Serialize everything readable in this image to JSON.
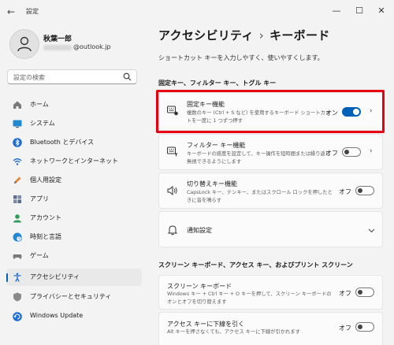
{
  "window": {
    "title": "設定"
  },
  "user": {
    "name": "秋葉一郎",
    "email_suffix": "@outlook.jp"
  },
  "search": {
    "placeholder": "設定の検索"
  },
  "nav": [
    {
      "label": "ホーム",
      "icon": "home-icon"
    },
    {
      "label": "システム",
      "icon": "monitor-icon"
    },
    {
      "label": "Bluetooth とデバイス",
      "icon": "bluetooth-icon"
    },
    {
      "label": "ネットワークとインターネット",
      "icon": "wifi-icon"
    },
    {
      "label": "個人用設定",
      "icon": "pen-icon"
    },
    {
      "label": "アプリ",
      "icon": "apps-icon"
    },
    {
      "label": "アカウント",
      "icon": "account-icon"
    },
    {
      "label": "時刻と言語",
      "icon": "clock-globe-icon"
    },
    {
      "label": "ゲーム",
      "icon": "gamepad-icon"
    },
    {
      "label": "アクセシビリティ",
      "icon": "accessibility-icon"
    },
    {
      "label": "プライバシーとセキュリティ",
      "icon": "shield-icon"
    },
    {
      "label": "Windows Update",
      "icon": "update-icon"
    }
  ],
  "main": {
    "breadcrumb_parent": "アクセシビリティ",
    "breadcrumb_sep": "›",
    "breadcrumb_current": "キーボード",
    "description": "ショートカット キーを入力しやすく、使いやすくします。",
    "section1_title": "固定キー、フィルター キー、トグル キー",
    "cards": [
      {
        "title": "固定キー機能",
        "desc": "複数のキー (Ctrl + S など) を使用するキーボード ショートカットを一度に 1 つずつ押す",
        "state": "オン",
        "on": true,
        "icon": "sticky-keys-icon"
      },
      {
        "title": "フィルター キー機能",
        "desc": "キーボードの感度を設定して、キー操作を短時間または繰り返し無視できるようにします",
        "state": "オフ",
        "on": false,
        "icon": "filter-keys-icon"
      },
      {
        "title": "切り替えキー機能",
        "desc": "CapsLock キー、テンキー、またはスクロール ロックを押したときに音を鳴らす",
        "state": "オフ",
        "on": false,
        "icon": "toggle-keys-icon"
      },
      {
        "title": "通知設定",
        "icon": "bell-icon"
      }
    ],
    "section2_title": "スクリーン キーボード、アクセス キー、およびプリント スクリーン",
    "cards2": [
      {
        "title": "スクリーン キーボード",
        "desc": "Windows キー + Ctrl キー + O キーを押して、スクリーン キーボードのオンとオフを切り替えます",
        "state": "オフ",
        "on": false
      },
      {
        "title": "アクセス キーに下線を引く",
        "desc": "Alt キーを押さなくても、アクセス キーに下線が引かれます",
        "state": "オフ",
        "on": false
      }
    ]
  },
  "colors": {
    "accent": "#005fb8",
    "highlight": "#e60012"
  }
}
